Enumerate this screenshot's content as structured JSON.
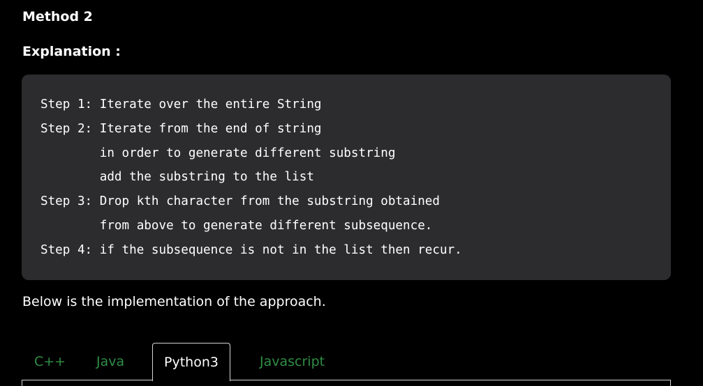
{
  "headings": {
    "method": "Method 2",
    "explanation": "Explanation :"
  },
  "code_block": {
    "lines": [
      "Step 1: Iterate over the entire String",
      "Step 2: Iterate from the end of string",
      "        in order to generate different substring",
      "        add the substring to the list",
      "Step 3: Drop kth character from the substring obtained",
      "        from above to generate different subsequence.",
      "Step 4: if the subsequence is not in the list then recur."
    ]
  },
  "intro_text": "Below is the implementation of the approach.",
  "tabs": {
    "items": [
      {
        "label": "C++",
        "active": false
      },
      {
        "label": "Java",
        "active": false
      },
      {
        "label": "Python3",
        "active": true
      },
      {
        "label": "Javascript",
        "active": false
      }
    ]
  },
  "colors": {
    "background": "#000000",
    "code_background": "#2c2c2e",
    "tab_inactive": "#2f8d46",
    "tab_active_text": "#ffffff"
  }
}
